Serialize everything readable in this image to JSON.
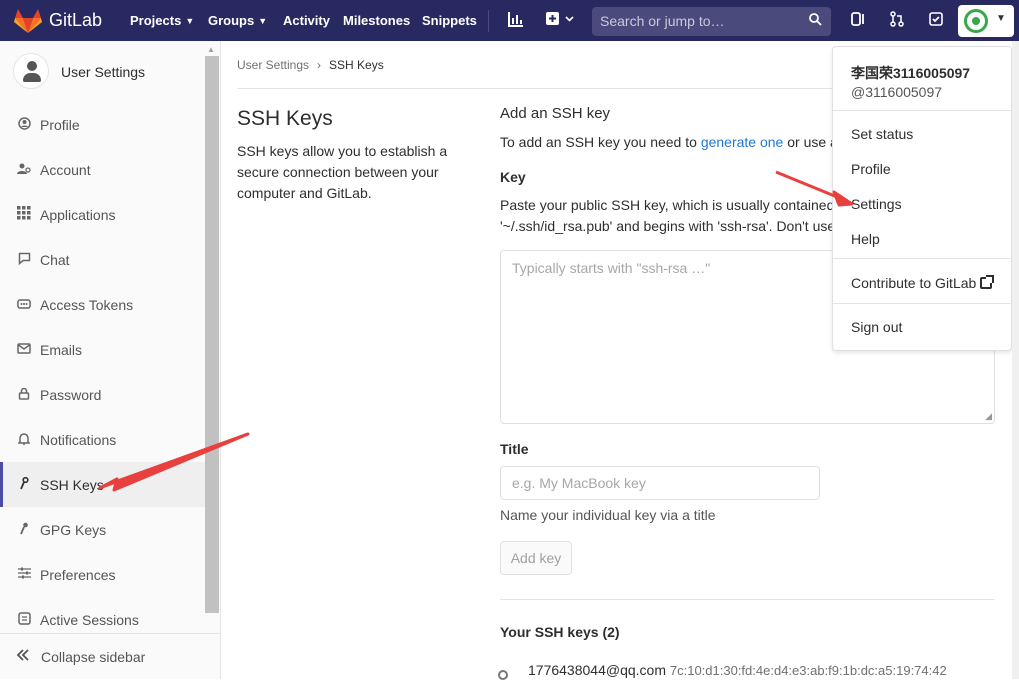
{
  "topbar": {
    "brand": "GitLab",
    "nav": [
      {
        "label": "Projects",
        "has_menu": true
      },
      {
        "label": "Groups",
        "has_menu": true
      },
      {
        "label": "Activity",
        "has_menu": false
      },
      {
        "label": "Milestones",
        "has_menu": false
      },
      {
        "label": "Snippets",
        "has_menu": false
      }
    ],
    "search_placeholder": "Search or jump to…",
    "icons": [
      "chart-icon",
      "plus-square-icon",
      "search-icon",
      "merge-request-icon",
      "todo-check-icon",
      "avatar"
    ]
  },
  "sidebar": {
    "title": "User Settings",
    "items": [
      {
        "label": "Profile",
        "icon": "profile-icon"
      },
      {
        "label": "Account",
        "icon": "account-icon"
      },
      {
        "label": "Applications",
        "icon": "applications-grid-icon"
      },
      {
        "label": "Chat",
        "icon": "chat-icon"
      },
      {
        "label": "Access Tokens",
        "icon": "access-tokens-icon"
      },
      {
        "label": "Emails",
        "icon": "envelope-icon"
      },
      {
        "label": "Password",
        "icon": "lock-icon"
      },
      {
        "label": "Notifications",
        "icon": "bell-icon"
      },
      {
        "label": "SSH Keys",
        "icon": "key-icon",
        "active": true
      },
      {
        "label": "GPG Keys",
        "icon": "gpg-key-icon"
      },
      {
        "label": "Preferences",
        "icon": "preferences-sliders-icon"
      },
      {
        "label": "Active Sessions",
        "icon": "sessions-icon"
      }
    ],
    "collapse_label": "Collapse sidebar"
  },
  "breadcrumb": {
    "parent": "User Settings",
    "separator": "›",
    "current": "SSH Keys"
  },
  "left_panel": {
    "heading": "SSH Keys",
    "description": "SSH keys allow you to establish a secure connection between your computer and GitLab."
  },
  "form": {
    "section_title": "Add an SSH key",
    "intro_prefix": "To add an SSH key you need to ",
    "intro_link": "generate one",
    "intro_suffix": " or use a",
    "key_label": "Key",
    "key_help_line1": "Paste your public SSH key, which is usually contained",
    "key_help_line2": "'~/.ssh/id_rsa.pub' and begins with 'ssh-rsa'. Don't use",
    "key_placeholder": "Typically starts with \"ssh-rsa …\"",
    "title_label": "Title",
    "title_placeholder": "e.g. My MacBook key",
    "title_help": "Name your individual key via a title",
    "add_button": "Add key"
  },
  "keys": {
    "heading": "Your SSH keys (2)",
    "items": [
      {
        "title": "1776438044@qq.com",
        "fingerprint": "7c:10:d1:30:fd:4e:d4:e3:ab:f9:1b:dc:a5:19:74:42"
      }
    ]
  },
  "user_menu": {
    "name": "李国荣3116005097",
    "username": "@3116005097",
    "items": [
      "Set status",
      "Profile",
      "Settings",
      "Help"
    ],
    "contribute": "Contribute to GitLab",
    "sign_out": "Sign out"
  },
  "colors": {
    "topbar": "#292961",
    "link": "#1f78d1",
    "annotation_arrow": "#e8403f",
    "active_border": "#4b4ba3"
  }
}
